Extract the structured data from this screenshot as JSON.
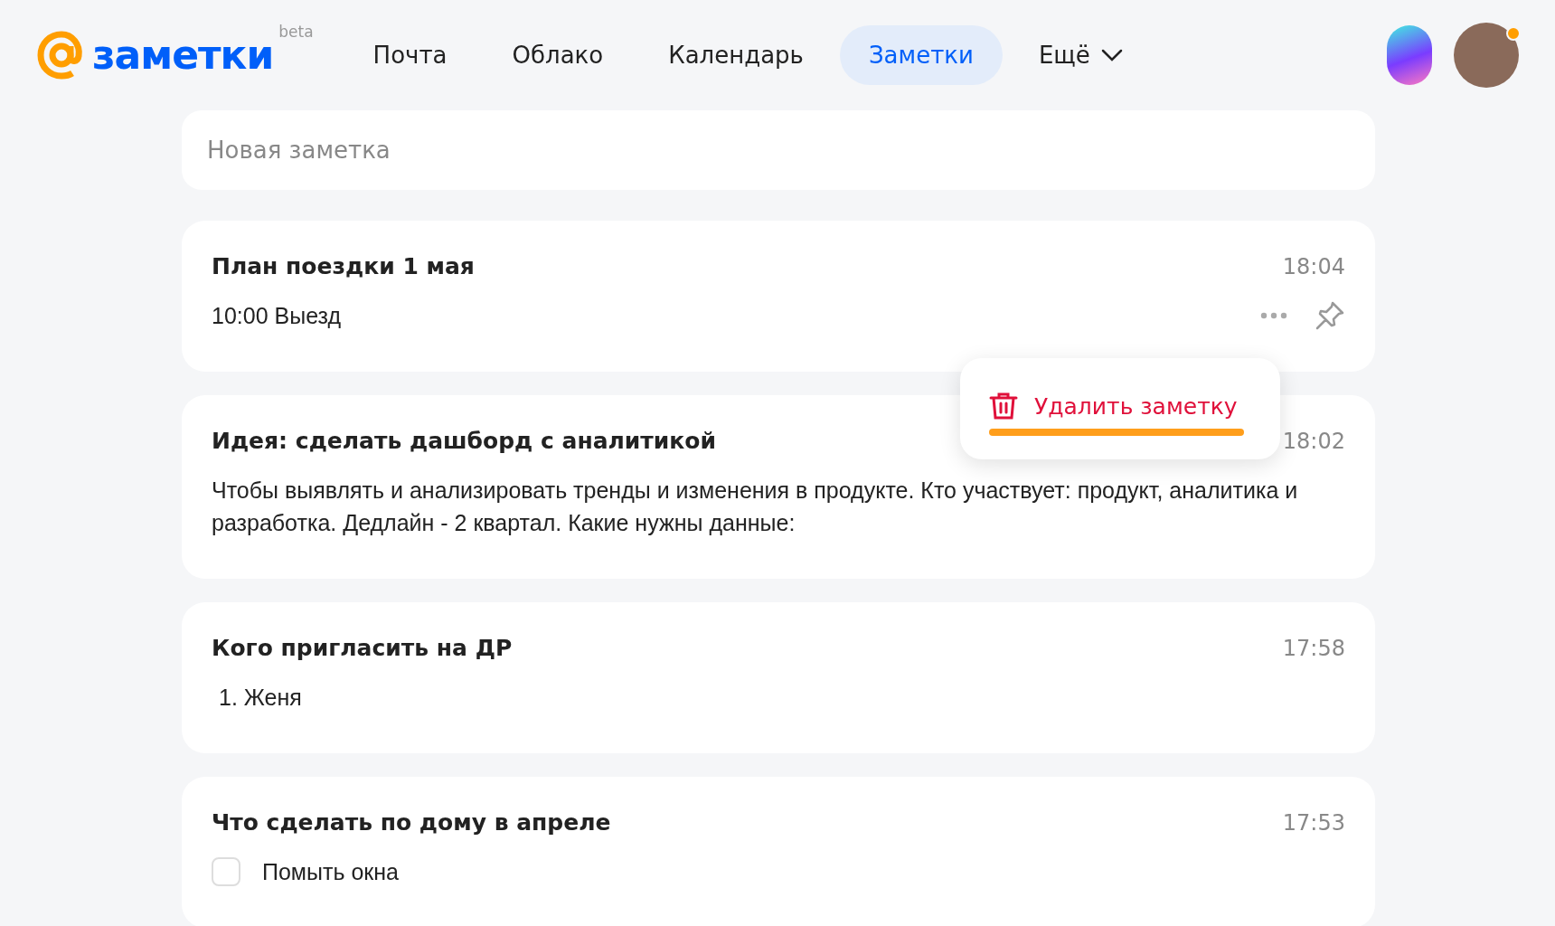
{
  "header": {
    "logo": {
      "text": "заметки",
      "badge": "beta"
    },
    "nav": [
      {
        "label": "Почта",
        "selected": false
      },
      {
        "label": "Облако",
        "selected": false
      },
      {
        "label": "Календарь",
        "selected": false
      },
      {
        "label": "Заметки",
        "selected": true
      },
      {
        "label": "Ещё",
        "selected": false,
        "kind": "dropdown"
      }
    ],
    "user": {
      "notification": true
    }
  },
  "new_note": {
    "placeholder": "Новая заметка"
  },
  "notes": [
    {
      "title": "План поездки 1 мая",
      "time": "18:04",
      "kind": "text",
      "body": "10:00 Выезд",
      "show_actions": true
    },
    {
      "title": "Идея: сделать дашборд с аналитикой",
      "time": "18:02",
      "kind": "text",
      "body": "Чтобы выявлять и анализировать тренды и изменения в продукте. Кто участвует: продукт, аналитика и разработка. Дедлайн - 2 квартал. Какие нужны данные:",
      "show_actions": false
    },
    {
      "title": "Кого пригласить на ДР",
      "time": "17:58",
      "kind": "list",
      "items": [
        "1. Женя"
      ],
      "show_actions": false
    },
    {
      "title": "Что сделать по дому в апреле",
      "time": "17:53",
      "kind": "checklist",
      "items": [
        {
          "label": "Помыть окна",
          "checked": false
        }
      ],
      "show_actions": false
    }
  ],
  "context_menu": {
    "items": [
      {
        "label": "Удалить заметку",
        "kind": "delete",
        "highlighted": true
      }
    ]
  }
}
